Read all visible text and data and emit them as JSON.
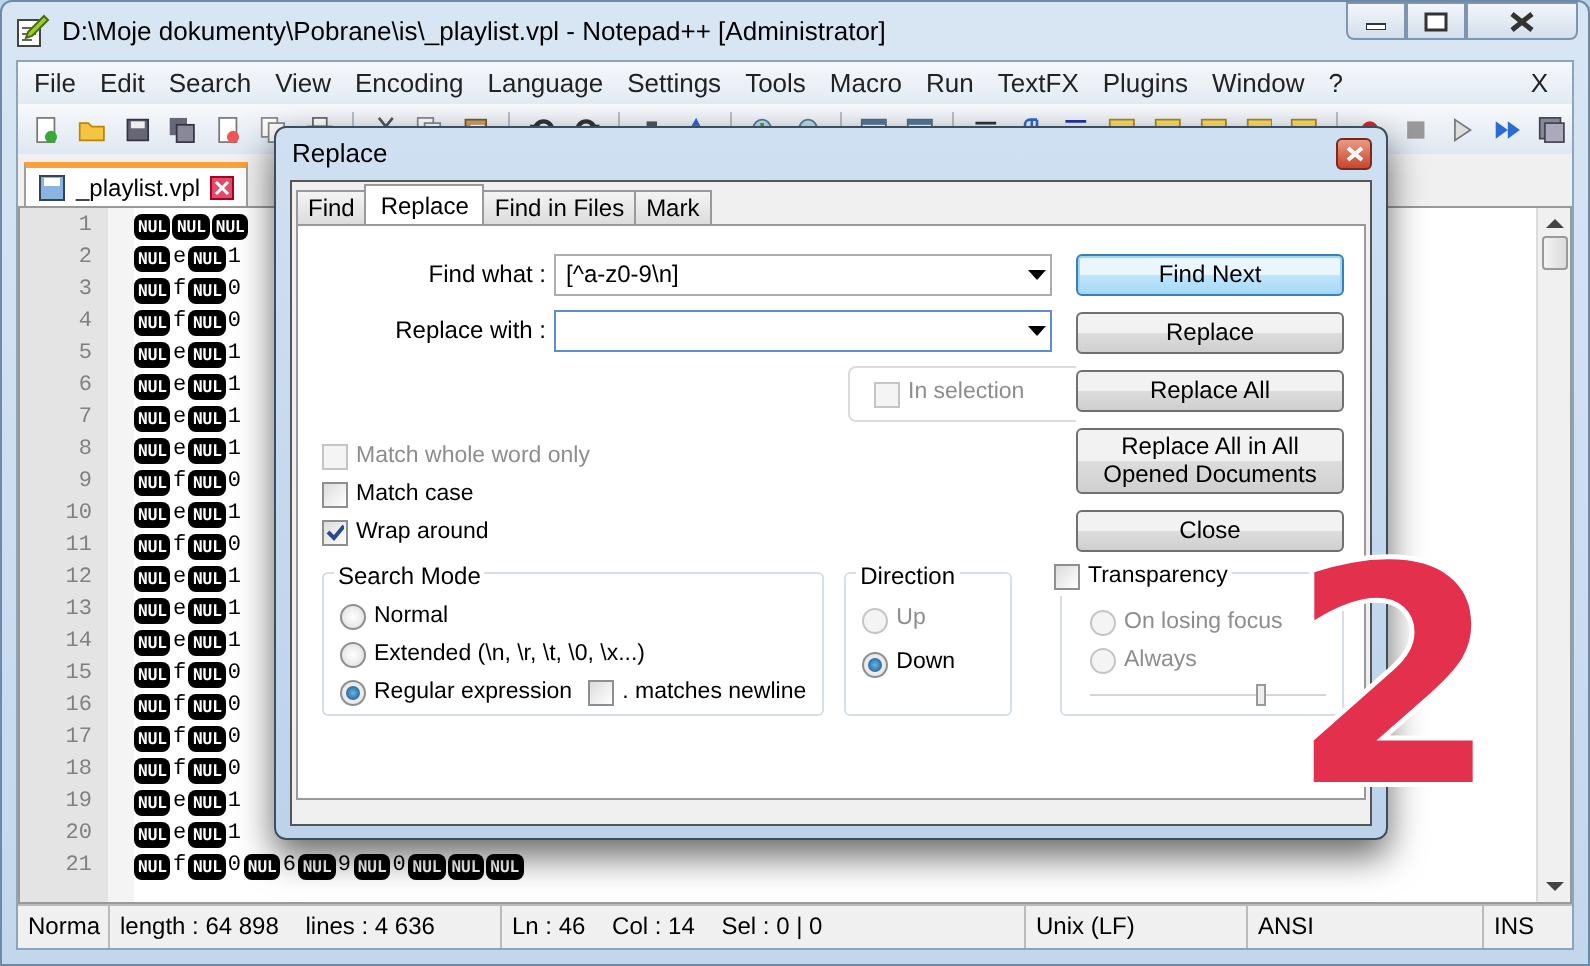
{
  "window": {
    "title": "D:\\Moje dokumenty\\Pobrane\\is\\_playlist.vpl - Notepad++ [Administrator]"
  },
  "menu": [
    "File",
    "Edit",
    "Search",
    "View",
    "Encoding",
    "Language",
    "Settings",
    "Tools",
    "Macro",
    "Run",
    "TextFX",
    "Plugins",
    "Window",
    "?"
  ],
  "menu_close": "X",
  "file_tabs": [
    {
      "label": "_playlist.vpl",
      "selected": true
    }
  ],
  "editor": {
    "lines": [
      {
        "number": "1",
        "tokens": [
          {
            "kind": "nul",
            "text": "NUL"
          },
          {
            "kind": "nul",
            "text": "NUL"
          },
          {
            "kind": "nul",
            "text": "NUL"
          }
        ]
      },
      {
        "number": "2",
        "tokens": [
          {
            "kind": "nul",
            "text": "NUL"
          },
          {
            "kind": "char",
            "text": "e"
          },
          {
            "kind": "nul",
            "text": "NUL"
          },
          {
            "kind": "char",
            "text": "1"
          }
        ]
      },
      {
        "number": "3",
        "tokens": [
          {
            "kind": "nul",
            "text": "NUL"
          },
          {
            "kind": "char",
            "text": "f"
          },
          {
            "kind": "nul",
            "text": "NUL"
          },
          {
            "kind": "char",
            "text": "0"
          }
        ]
      },
      {
        "number": "4",
        "tokens": [
          {
            "kind": "nul",
            "text": "NUL"
          },
          {
            "kind": "char",
            "text": "f"
          },
          {
            "kind": "nul",
            "text": "NUL"
          },
          {
            "kind": "char",
            "text": "0"
          }
        ]
      },
      {
        "number": "5",
        "tokens": [
          {
            "kind": "nul",
            "text": "NUL"
          },
          {
            "kind": "char",
            "text": "e"
          },
          {
            "kind": "nul",
            "text": "NUL"
          },
          {
            "kind": "char",
            "text": "1"
          }
        ]
      },
      {
        "number": "6",
        "tokens": [
          {
            "kind": "nul",
            "text": "NUL"
          },
          {
            "kind": "char",
            "text": "e"
          },
          {
            "kind": "nul",
            "text": "NUL"
          },
          {
            "kind": "char",
            "text": "1"
          }
        ]
      },
      {
        "number": "7",
        "tokens": [
          {
            "kind": "nul",
            "text": "NUL"
          },
          {
            "kind": "char",
            "text": "e"
          },
          {
            "kind": "nul",
            "text": "NUL"
          },
          {
            "kind": "char",
            "text": "1"
          }
        ]
      },
      {
        "number": "8",
        "tokens": [
          {
            "kind": "nul",
            "text": "NUL"
          },
          {
            "kind": "char",
            "text": "e"
          },
          {
            "kind": "nul",
            "text": "NUL"
          },
          {
            "kind": "char",
            "text": "1"
          }
        ]
      },
      {
        "number": "9",
        "tokens": [
          {
            "kind": "nul",
            "text": "NUL"
          },
          {
            "kind": "char",
            "text": "f"
          },
          {
            "kind": "nul",
            "text": "NUL"
          },
          {
            "kind": "char",
            "text": "0"
          }
        ]
      },
      {
        "number": "10",
        "tokens": [
          {
            "kind": "nul",
            "text": "NUL"
          },
          {
            "kind": "char",
            "text": "e"
          },
          {
            "kind": "nul",
            "text": "NUL"
          },
          {
            "kind": "char",
            "text": "1"
          }
        ]
      },
      {
        "number": "11",
        "tokens": [
          {
            "kind": "nul",
            "text": "NUL"
          },
          {
            "kind": "char",
            "text": "f"
          },
          {
            "kind": "nul",
            "text": "NUL"
          },
          {
            "kind": "char",
            "text": "0"
          }
        ]
      },
      {
        "number": "12",
        "tokens": [
          {
            "kind": "nul",
            "text": "NUL"
          },
          {
            "kind": "char",
            "text": "e"
          },
          {
            "kind": "nul",
            "text": "NUL"
          },
          {
            "kind": "char",
            "text": "1"
          }
        ]
      },
      {
        "number": "13",
        "tokens": [
          {
            "kind": "nul",
            "text": "NUL"
          },
          {
            "kind": "char",
            "text": "e"
          },
          {
            "kind": "nul",
            "text": "NUL"
          },
          {
            "kind": "char",
            "text": "1"
          }
        ]
      },
      {
        "number": "14",
        "tokens": [
          {
            "kind": "nul",
            "text": "NUL"
          },
          {
            "kind": "char",
            "text": "e"
          },
          {
            "kind": "nul",
            "text": "NUL"
          },
          {
            "kind": "char",
            "text": "1"
          }
        ]
      },
      {
        "number": "15",
        "tokens": [
          {
            "kind": "nul",
            "text": "NUL"
          },
          {
            "kind": "char",
            "text": "f"
          },
          {
            "kind": "nul",
            "text": "NUL"
          },
          {
            "kind": "char",
            "text": "0"
          }
        ]
      },
      {
        "number": "16",
        "tokens": [
          {
            "kind": "nul",
            "text": "NUL"
          },
          {
            "kind": "char",
            "text": "f"
          },
          {
            "kind": "nul",
            "text": "NUL"
          },
          {
            "kind": "char",
            "text": "0"
          }
        ]
      },
      {
        "number": "17",
        "tokens": [
          {
            "kind": "nul",
            "text": "NUL"
          },
          {
            "kind": "char",
            "text": "f"
          },
          {
            "kind": "nul",
            "text": "NUL"
          },
          {
            "kind": "char",
            "text": "0"
          }
        ]
      },
      {
        "number": "18",
        "tokens": [
          {
            "kind": "nul",
            "text": "NUL"
          },
          {
            "kind": "char",
            "text": "f"
          },
          {
            "kind": "nul",
            "text": "NUL"
          },
          {
            "kind": "char",
            "text": "0"
          }
        ]
      },
      {
        "number": "19",
        "tokens": [
          {
            "kind": "nul",
            "text": "NUL"
          },
          {
            "kind": "char",
            "text": "e"
          },
          {
            "kind": "nul",
            "text": "NUL"
          },
          {
            "kind": "char",
            "text": "1"
          }
        ]
      },
      {
        "number": "20",
        "tokens": [
          {
            "kind": "nul",
            "text": "NUL"
          },
          {
            "kind": "char",
            "text": "e"
          },
          {
            "kind": "nul",
            "text": "NUL"
          },
          {
            "kind": "char",
            "text": "1"
          }
        ]
      },
      {
        "number": "21",
        "tokens": [
          {
            "kind": "nul",
            "text": "NUL"
          },
          {
            "kind": "char",
            "text": "f"
          },
          {
            "kind": "nul",
            "text": "NUL"
          },
          {
            "kind": "char",
            "text": "0"
          },
          {
            "kind": "nul",
            "text": "NUL"
          },
          {
            "kind": "char",
            "text": "6"
          },
          {
            "kind": "nul",
            "text": "NUL"
          },
          {
            "kind": "char",
            "text": "9"
          },
          {
            "kind": "nul",
            "text": "NUL"
          },
          {
            "kind": "char",
            "text": "0"
          },
          {
            "kind": "nul",
            "text": "NUL"
          },
          {
            "kind": "nul",
            "text": "NUL"
          },
          {
            "kind": "nul",
            "text": "NUL"
          }
        ]
      }
    ]
  },
  "status_bar": [
    "Norma",
    "length : 64 898    lines : 4 636",
    "Ln : 46    Col : 14    Sel : 0 | 0",
    "Unix (LF)",
    "ANSI",
    "INS"
  ],
  "dialog": {
    "title": "Replace",
    "tabs": [
      {
        "label": "Find",
        "selected": false
      },
      {
        "label": "Replace",
        "selected": true
      },
      {
        "label": "Find in Files",
        "selected": false
      },
      {
        "label": "Mark",
        "selected": false
      }
    ],
    "fields": [
      {
        "label": "Find what :",
        "value": "[^a-z0-9\\n]"
      },
      {
        "label": "Replace with :"
      }
    ],
    "in_selection": {
      "label": "In selection",
      "checked": false,
      "disabled": true
    },
    "buttons": [
      {
        "label": "Find Next",
        "default": true
      },
      {
        "label": "Replace",
        "default": false
      },
      {
        "label": "Replace All",
        "default": false
      },
      {
        "label": "Replace All in All Opened Documents",
        "default": false
      },
      {
        "label": "Close",
        "default": false
      }
    ],
    "options": [
      {
        "label": "Match whole word only",
        "checked": false,
        "disabled": true
      },
      {
        "label": "Match case",
        "checked": false,
        "disabled": false
      },
      {
        "label": "Wrap around",
        "checked": true,
        "disabled": false
      }
    ],
    "search_mode": {
      "title": "Search Mode",
      "options": [
        {
          "label": "Normal",
          "selected": false
        },
        {
          "label": "Extended (\\n, \\r, \\t, \\0, \\x...)",
          "selected": false
        },
        {
          "label": "Regular expression",
          "selected": true
        }
      ],
      "dot_matches_newline": {
        "label": ". matches newline",
        "checked": false
      }
    },
    "direction": {
      "title": "Direction",
      "options": [
        {
          "label": "Up",
          "selected": false,
          "disabled": true
        },
        {
          "label": "Down",
          "selected": true,
          "disabled": false
        }
      ]
    },
    "transparency": {
      "label": "Transparency",
      "checked": false,
      "options": [
        {
          "label": "On losing focus",
          "selected": false
        },
        {
          "label": "Always",
          "selected": false
        }
      ],
      "level": 0.72
    }
  },
  "annotation": "2"
}
